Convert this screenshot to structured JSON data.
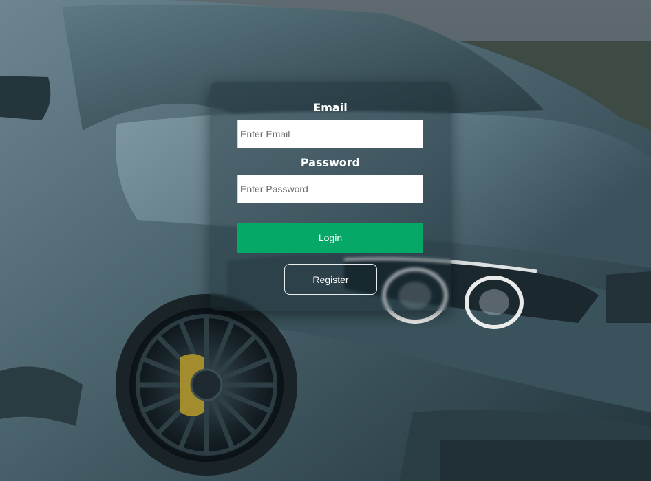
{
  "login_form": {
    "email_label": "Email",
    "email_placeholder": "Enter Email",
    "email_value": "",
    "password_label": "Password",
    "password_placeholder": "Enter Password",
    "password_value": "",
    "login_button": "Login",
    "register_button": "Register"
  },
  "colors": {
    "login_button_bg": "#05a866",
    "label_text": "#ffffff",
    "register_border": "#e8eef0"
  },
  "background": {
    "subject": "car-photo"
  }
}
